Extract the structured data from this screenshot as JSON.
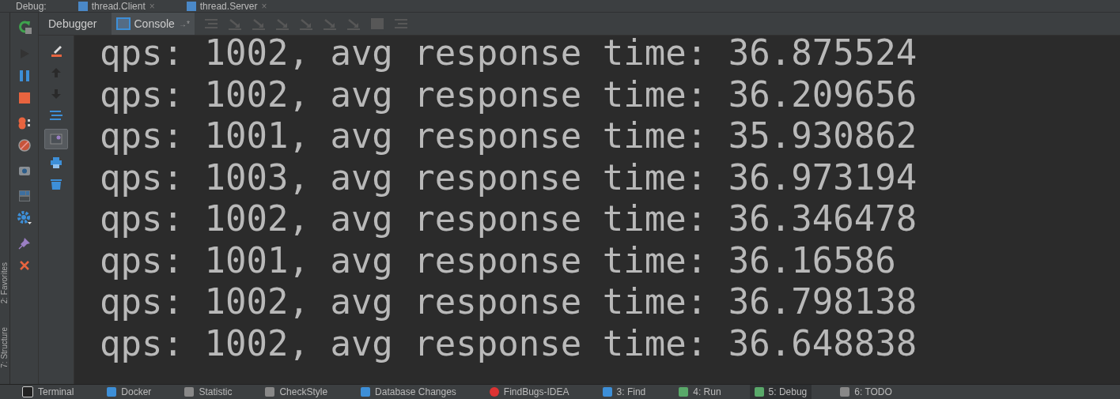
{
  "window": {
    "title": "Debug:"
  },
  "editor_tabs": [
    {
      "label": "thread.Client",
      "close": "×"
    },
    {
      "label": "thread.Server",
      "close": "×"
    }
  ],
  "debug_tabs": [
    {
      "label": "Debugger",
      "selected": false,
      "kind": "plain"
    },
    {
      "label": "Console",
      "selected": true,
      "kind": "console",
      "pin": "→*"
    }
  ],
  "stepping_tools": [
    {
      "kind": "lines",
      "disabled": true
    },
    {
      "kind": "over",
      "disabled": true
    },
    {
      "kind": "into",
      "disabled": true
    },
    {
      "kind": "force",
      "disabled": true
    },
    {
      "kind": "out",
      "disabled": true
    },
    {
      "kind": "drop",
      "disabled": true
    },
    {
      "kind": "cursor",
      "disabled": true
    },
    {
      "kind": "grid",
      "disabled": true
    },
    {
      "kind": "trace",
      "disabled": true
    }
  ],
  "side_tools": [
    {
      "kind": "play",
      "disabled": true
    },
    {
      "kind": "pause",
      "disabled": false
    },
    {
      "kind": "stop",
      "disabled": false
    },
    {
      "kind": "breakpoints",
      "disabled": false
    },
    {
      "kind": "mute",
      "disabled": false
    },
    {
      "kind": "camera",
      "disabled": false
    },
    {
      "kind": "layout",
      "disabled": false
    },
    {
      "kind": "gear",
      "disabled": false
    },
    {
      "kind": "pin",
      "disabled": false
    },
    {
      "kind": "close",
      "disabled": false
    }
  ],
  "console_tools": [
    {
      "kind": "eraser",
      "disabled": false,
      "selected": false
    },
    {
      "kind": "up",
      "disabled": true,
      "selected": false
    },
    {
      "kind": "down",
      "disabled": true,
      "selected": false
    },
    {
      "kind": "wrap",
      "disabled": false,
      "selected": false
    },
    {
      "kind": "scroll",
      "disabled": false,
      "selected": true
    },
    {
      "kind": "print",
      "disabled": false,
      "selected": false
    },
    {
      "kind": "trash",
      "disabled": false,
      "selected": false
    }
  ],
  "side_strip": [
    "2: Favorites",
    "7: Structure"
  ],
  "console_lines": [
    "qps: 1002, avg response time: 36.875524",
    "qps: 1002, avg response time: 36.209656",
    "qps: 1001, avg response time: 35.930862",
    "qps: 1003, avg response time: 36.973194",
    "qps: 1002, avg response time: 36.346478",
    "qps: 1001, avg response time: 36.16586",
    "qps: 1002, avg response time: 36.798138",
    "qps: 1002, avg response time: 36.648838"
  ],
  "tool_windows": [
    {
      "label": "Terminal",
      "selected": false,
      "kind": "terminal"
    },
    {
      "label": "Docker",
      "selected": false,
      "kind": "docker"
    },
    {
      "label": "Statistic",
      "selected": false,
      "kind": "stat"
    },
    {
      "label": "CheckStyle",
      "selected": false,
      "kind": "check"
    },
    {
      "label": "Database Changes",
      "selected": false,
      "kind": "db"
    },
    {
      "label": "FindBugs-IDEA",
      "selected": false,
      "kind": "bug"
    },
    {
      "label": "3: Find",
      "selected": false,
      "kind": "find"
    },
    {
      "label": "4: Run",
      "selected": false,
      "kind": "run"
    },
    {
      "label": "5: Debug",
      "selected": true,
      "kind": "debug"
    },
    {
      "label": "6: TODO",
      "selected": false,
      "kind": "todo"
    }
  ]
}
